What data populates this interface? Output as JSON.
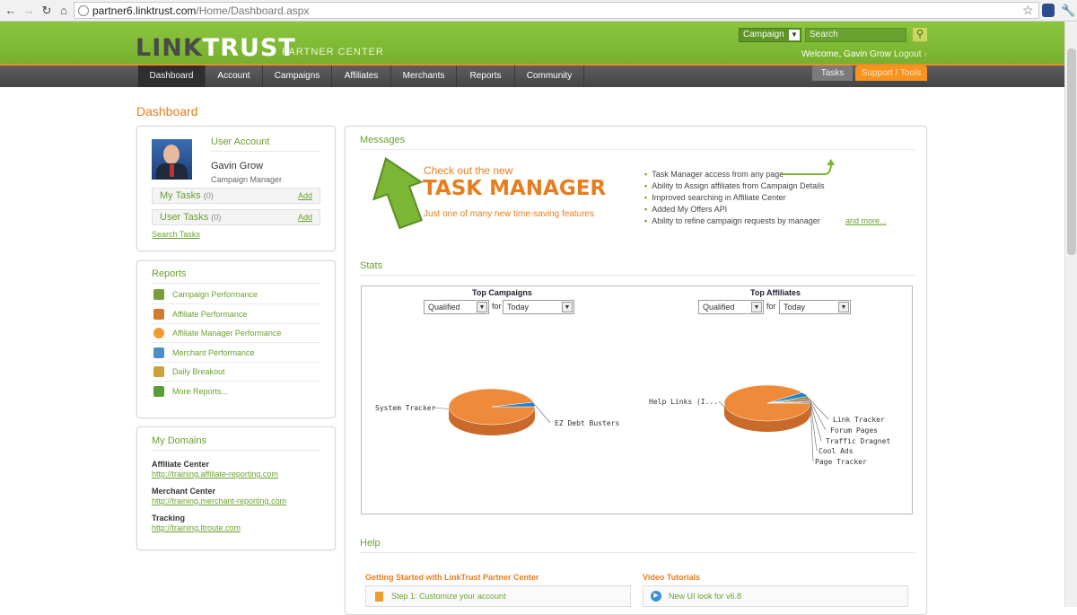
{
  "browser": {
    "url_host": "partner6.linktrust.com",
    "url_path": "/Home/Dashboard.aspx"
  },
  "header": {
    "logo_part1": "LINK",
    "logo_part2": "TRUST",
    "partner_center": "PARTNER CENTER",
    "search_scope": "Campaign",
    "search_placeholder": "Search",
    "welcome": "Welcome, Gavin Grow",
    "logout": "Logout"
  },
  "nav": {
    "items": [
      "Dashboard",
      "Account",
      "Campaigns",
      "Affiliates",
      "Merchants",
      "Reports",
      "Community"
    ],
    "tasks_tab": "Tasks",
    "support_tab": "Support / Tools"
  },
  "page_title": "Dashboard",
  "user_account": {
    "title": "User Account",
    "name": "Gavin Grow",
    "role": "Campaign Manager",
    "my_tasks": "My Tasks",
    "my_tasks_count": "(0)",
    "user_tasks": "User Tasks",
    "user_tasks_count": "(0)",
    "add": "Add",
    "search_tasks": "Search Tasks"
  },
  "reports": {
    "title": "Reports",
    "items": [
      {
        "label": "Campaign Performance",
        "icon": "campaign-icon",
        "color": "#7a9e3a"
      },
      {
        "label": "Affiliate Performance",
        "icon": "affiliate-icon",
        "color": "#d07a2e"
      },
      {
        "label": "Affiliate Manager Performance",
        "icon": "user-icon",
        "color": "#f39a2b"
      },
      {
        "label": "Merchant Performance",
        "icon": "merchant-icon",
        "color": "#4b8fc9"
      },
      {
        "label": "Daily Breakout",
        "icon": "calendar-icon",
        "color": "#c9a23a"
      },
      {
        "label": "More Reports...",
        "icon": "bar-chart-icon",
        "color": "#5a9e3a"
      }
    ]
  },
  "domains": {
    "title": "My Domains",
    "items": [
      {
        "label": "Affiliate Center",
        "url": "http://training.affiliate-reporting.com"
      },
      {
        "label": "Merchant Center",
        "url": "http://training.merchant-reporting.com"
      },
      {
        "label": "Tracking",
        "url": "http://training.ltroute.com"
      }
    ]
  },
  "messages": {
    "title": "Messages",
    "promo_line1": "Check out the new",
    "promo_line2": "TASK MANAGER",
    "promo_line3": "Just one of many new time-saving features",
    "bullets": [
      "Task Manager access from any page",
      "Ability to Assign affiliates from Campaign Details",
      "Improved searching in Affiliate Center",
      "Added My Offers API",
      "Ability to refine campaign requests by manager"
    ],
    "more": "and more..."
  },
  "stats": {
    "title": "Stats",
    "for": "for",
    "left": {
      "title": "Top Campaigns",
      "metric": "Qualified",
      "period": "Today"
    },
    "right": {
      "title": "Top Affiliates",
      "metric": "Qualified",
      "period": "Today"
    }
  },
  "chart_data": [
    {
      "type": "pie",
      "title": "Top Campaigns",
      "labels": [
        "System Tracker",
        "EZ Debt Busters"
      ],
      "values": [
        96,
        4
      ]
    },
    {
      "type": "pie",
      "title": "Top Affiliates",
      "labels": [
        "Help Links (I...",
        "Link Tracker",
        "Forum Pages",
        "Traffic Dragnet",
        "Cool Ads",
        "Page Tracker"
      ],
      "values": [
        90,
        4,
        2,
        2,
        1,
        1
      ]
    }
  ],
  "help": {
    "title": "Help",
    "getting_started": "Getting Started with LinkTrust Partner Center",
    "step1": "Step 1: Customize your account",
    "video_tutorials": "Video Tutorials",
    "video1": "New UI look for v6.8"
  },
  "colors": {
    "brand_green": "#76b02e",
    "accent_orange": "#e87d1e",
    "link_green": "#6aa22f"
  }
}
